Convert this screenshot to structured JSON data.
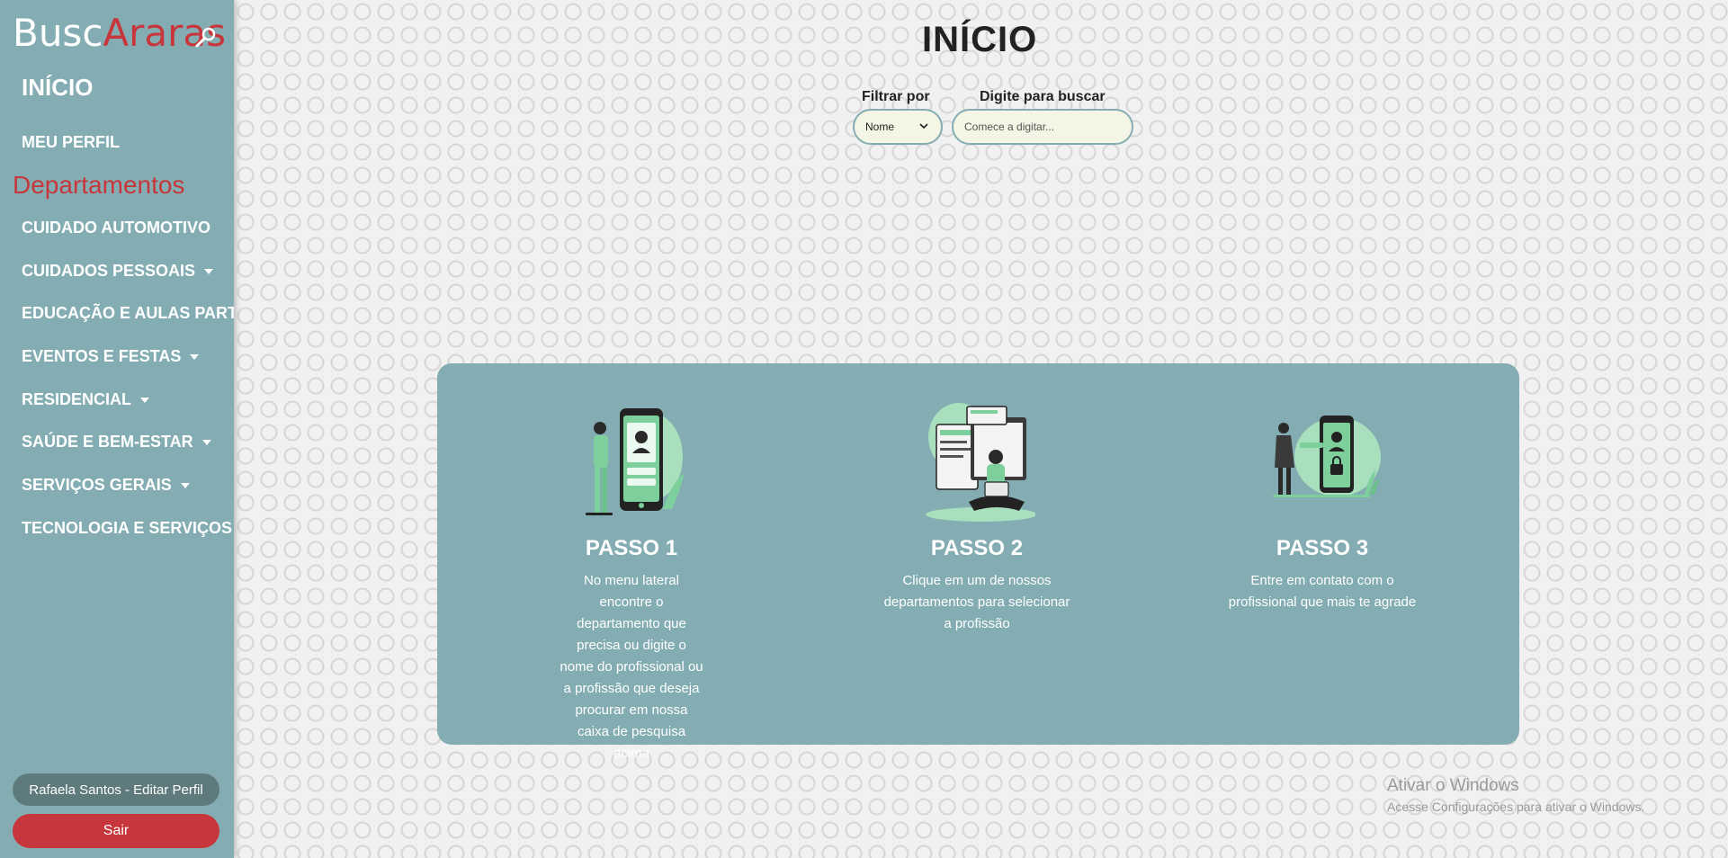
{
  "logo": {
    "part1": "Busc",
    "part2": "Araras",
    "icon": "search-icon"
  },
  "nav": {
    "home": "INÍCIO",
    "profile": "MEU PERFIL"
  },
  "departments": {
    "title": "Departamentos",
    "items": [
      {
        "label": "CUIDADO AUTOMOTIVO",
        "has_caret": false
      },
      {
        "label": "CUIDADOS PESSOAIS",
        "has_caret": true
      },
      {
        "label": "EDUCAÇÃO E AULAS PARTICULARES",
        "has_caret": false
      },
      {
        "label": "EVENTOS E FESTAS",
        "has_caret": true
      },
      {
        "label": "RESIDENCIAL",
        "has_caret": true
      },
      {
        "label": "SAÚDE E BEM-ESTAR",
        "has_caret": true
      },
      {
        "label": "SERVIÇOS GERAIS",
        "has_caret": true
      },
      {
        "label": "TECNOLOGIA E SERVIÇOS",
        "has_caret": false
      }
    ]
  },
  "user": {
    "edit_label": "Rafaela Santos - Editar Perfil",
    "logout_label": "Sair"
  },
  "main": {
    "title": "INÍCIO",
    "filter_label": "Filtrar por",
    "filter_value": "Nome",
    "search_label": "Digite para buscar",
    "search_placeholder": "Comece a digitar..."
  },
  "steps": [
    {
      "title": "PASSO 1",
      "text": "No menu lateral encontre o departamento que precisa ou digite o nome do profissional ou a profissão que deseja procurar em nossa caixa de pesquisa acima",
      "icon": "phone-profile-illustration"
    },
    {
      "title": "PASSO 2",
      "text": "Clique em um de nossos departamentos para selecionar a profissão",
      "icon": "person-laptop-illustration"
    },
    {
      "title": "PASSO 3",
      "text": "Entre em contato com o profissional que mais te agrade",
      "icon": "phone-lock-illustration"
    }
  ],
  "watermark": {
    "line1": "Ativar o Windows",
    "line2": "Acesse Configurações para ativar o Windows."
  },
  "colors": {
    "sidebar": "#83adb2",
    "accent_red": "#c7363b",
    "input_bg": "#f5f5e6",
    "illustration_green": "#7dcf9b"
  }
}
